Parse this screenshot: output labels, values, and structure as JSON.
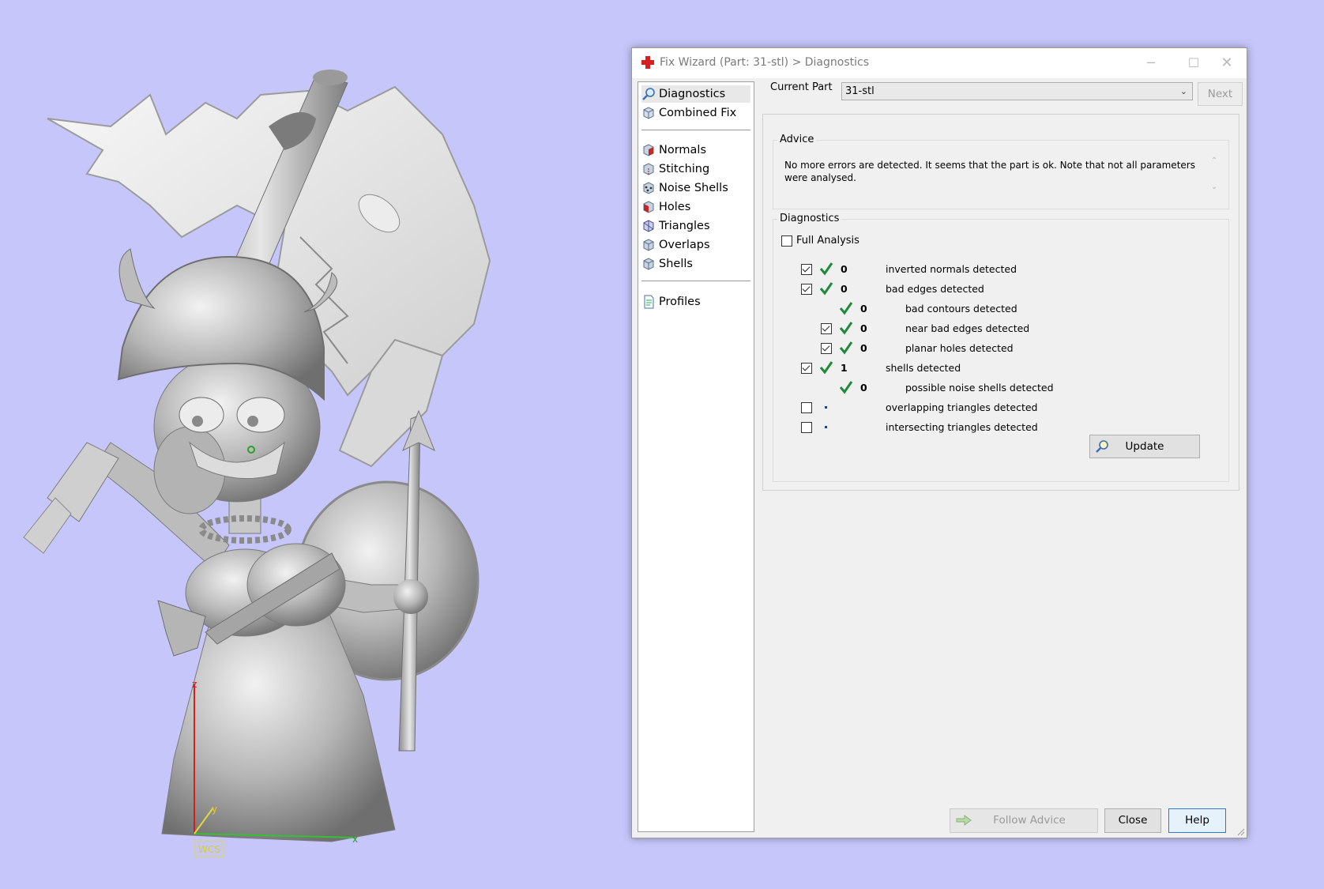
{
  "viewport": {
    "axis_z_label": "z",
    "axis_y_label": "y",
    "axis_x_label": "x",
    "wcs_label": "WCS"
  },
  "window": {
    "title": "Fix Wizard (Part: 31-stl) > Diagnostics",
    "minimize_icon": "─",
    "maximize_icon": "☐",
    "close_icon": "✕"
  },
  "nav": {
    "group1": [
      {
        "label": "Diagnostics",
        "icon": "magnifier-icon",
        "selected": true
      },
      {
        "label": "Combined Fix",
        "icon": "cube-icon"
      }
    ],
    "group2": [
      {
        "label": "Normals",
        "icon": "normals-cube-icon"
      },
      {
        "label": "Stitching",
        "icon": "stitching-cube-icon"
      },
      {
        "label": "Noise Shells",
        "icon": "noise-shells-cube-icon"
      },
      {
        "label": "Holes",
        "icon": "holes-cube-icon"
      },
      {
        "label": "Triangles",
        "icon": "triangles-cube-icon"
      },
      {
        "label": "Overlaps",
        "icon": "overlaps-cube-icon"
      },
      {
        "label": "Shells",
        "icon": "shells-cube-icon"
      }
    ],
    "group3": [
      {
        "label": "Profiles",
        "icon": "document-icon"
      }
    ]
  },
  "current_part": {
    "label": "Current Part",
    "value": "31-stl"
  },
  "next_label": "Next",
  "advice": {
    "title": "Advice",
    "text": "No more errors are detected. It seems that the part is ok. Note that not all parameters were analysed."
  },
  "diagnostics": {
    "title": "Diagnostics",
    "full_analysis_label": "Full Analysis",
    "full_analysis_checked": false,
    "rows": [
      {
        "checkbox": true,
        "checked": true,
        "status": "ok",
        "count": "0",
        "label": "inverted normals detected",
        "indent": 0
      },
      {
        "checkbox": true,
        "checked": true,
        "status": "ok",
        "count": "0",
        "label": "bad edges detected",
        "indent": 0
      },
      {
        "checkbox": false,
        "checked": false,
        "status": "ok",
        "count": "0",
        "label": "bad contours detected",
        "indent": 1
      },
      {
        "checkbox": true,
        "checked": true,
        "status": "ok",
        "count": "0",
        "label": "near bad edges detected",
        "indent": 1
      },
      {
        "checkbox": true,
        "checked": true,
        "status": "ok",
        "count": "0",
        "label": "planar holes detected",
        "indent": 1
      },
      {
        "checkbox": true,
        "checked": true,
        "status": "ok",
        "count": "1",
        "label": "shells detected",
        "indent": 0
      },
      {
        "checkbox": false,
        "checked": false,
        "status": "ok",
        "count": "0",
        "label": "possible noise shells detected",
        "indent": 1
      },
      {
        "checkbox": true,
        "checked": false,
        "status": "pending",
        "count": "",
        "label": "overlapping triangles detected",
        "indent": 0
      },
      {
        "checkbox": true,
        "checked": false,
        "status": "pending",
        "count": "",
        "label": "intersecting triangles detected",
        "indent": 0
      }
    ],
    "update_label": "Update"
  },
  "footer": {
    "follow_advice_label": "Follow Advice",
    "close_label": "Close",
    "help_label": "Help"
  },
  "colors": {
    "background": "#c6c6fb",
    "check_green": "#1e8a3a",
    "accent_blue": "#2a7ad2"
  }
}
